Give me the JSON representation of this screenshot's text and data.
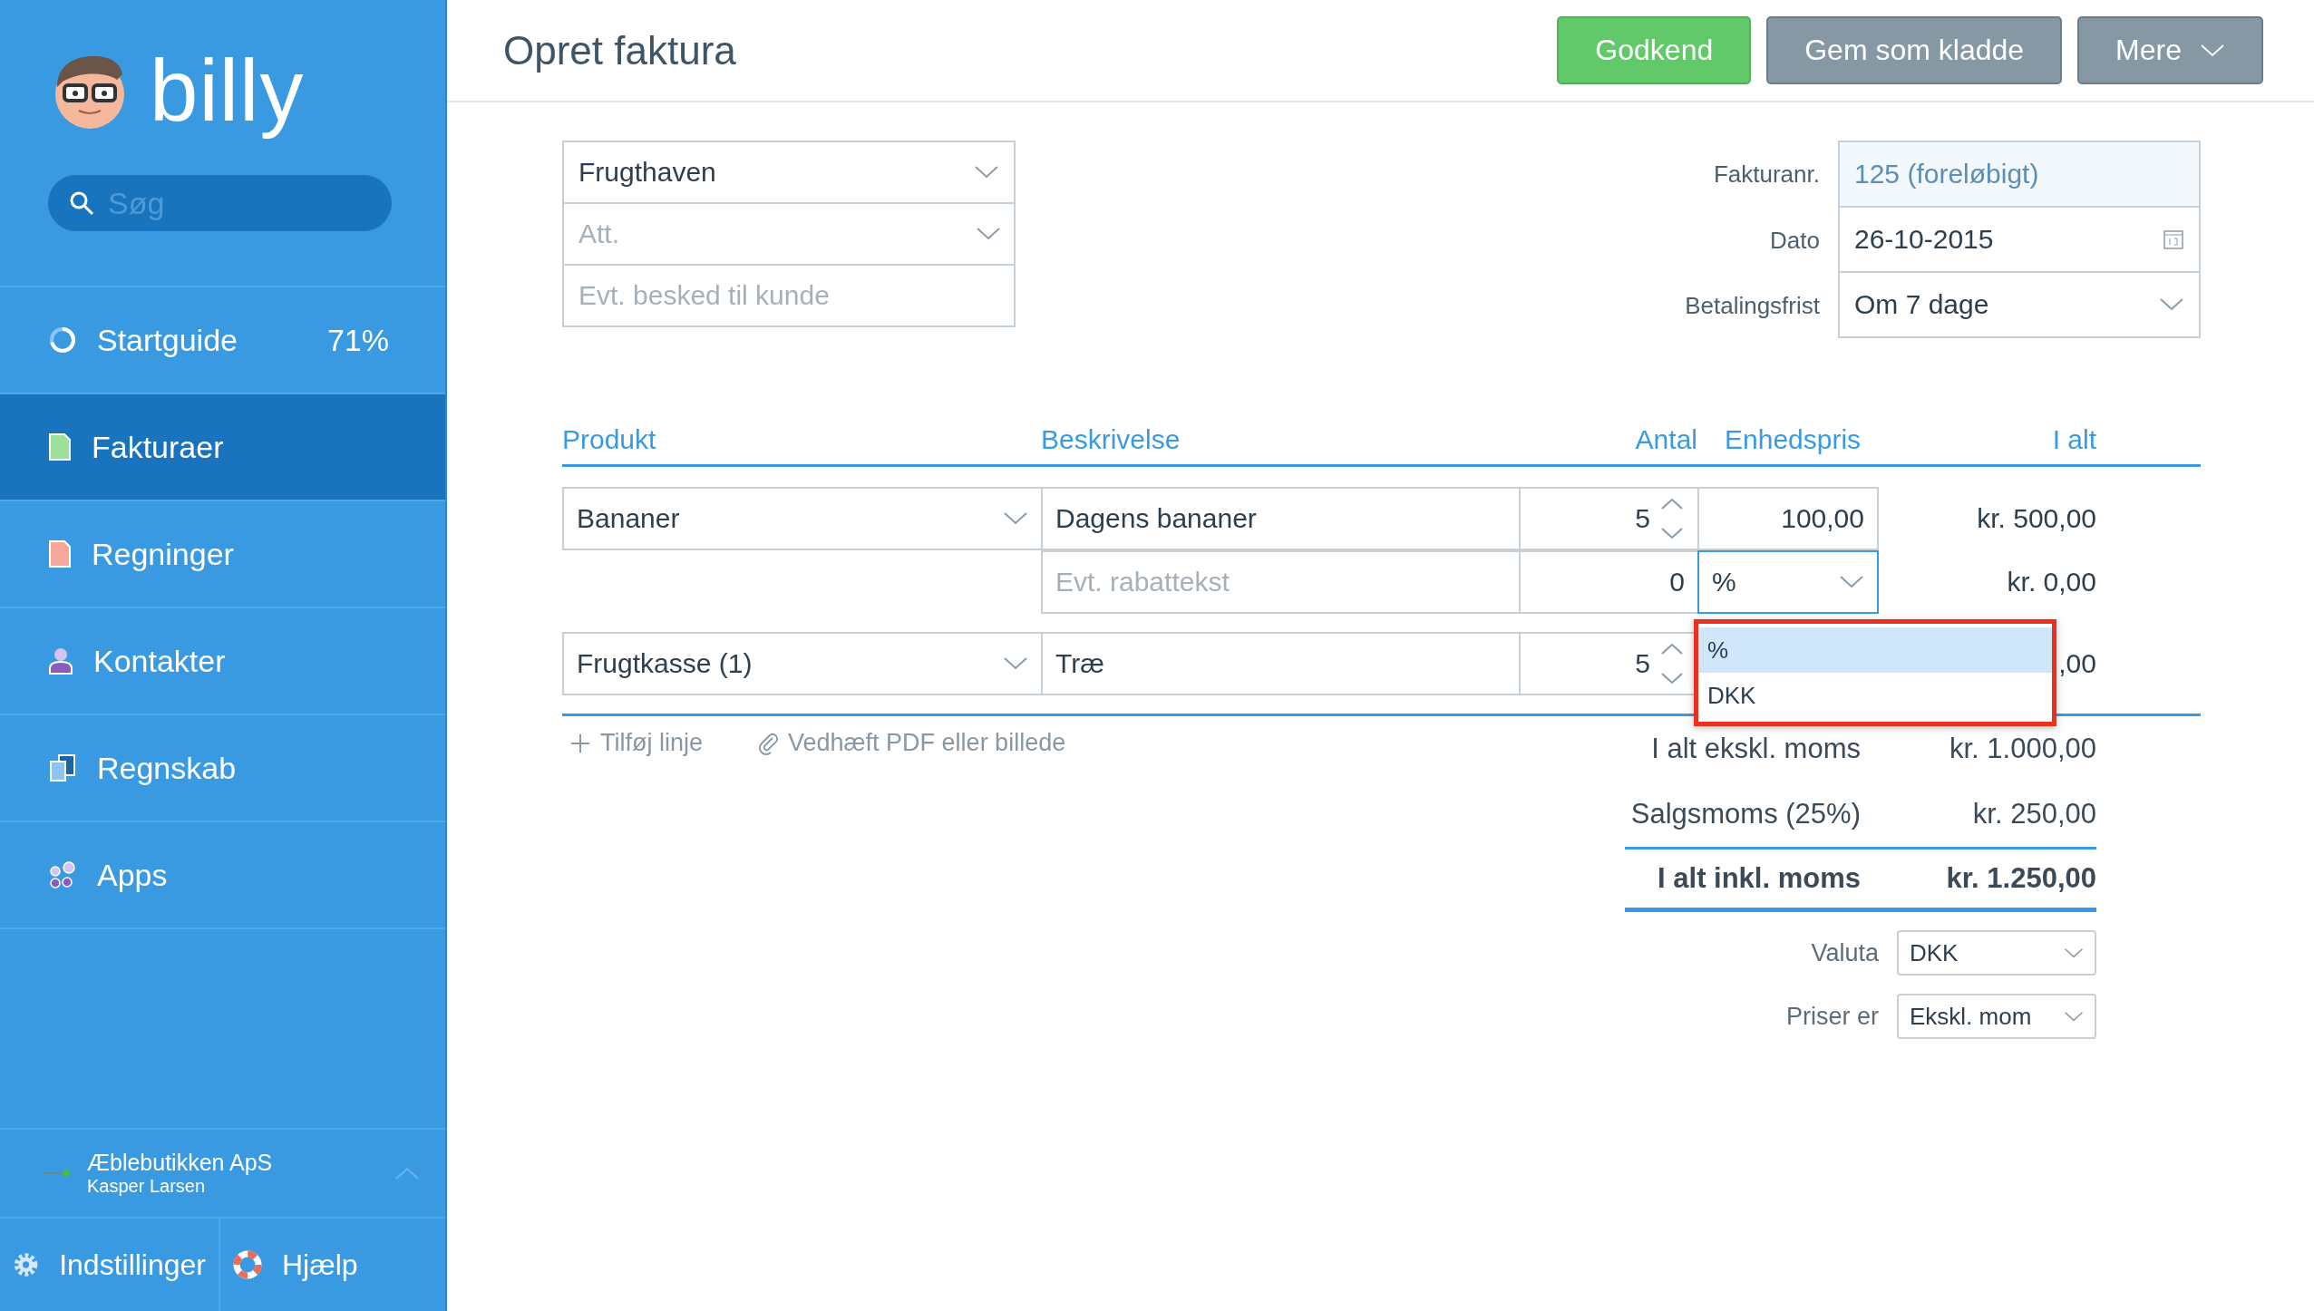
{
  "sidebar": {
    "logo": "billy",
    "search": {
      "placeholder": "Søg"
    },
    "items": [
      {
        "kind": "progress",
        "label": "Startguide",
        "badge": "71%",
        "level": 0.71,
        "selected": false
      },
      {
        "kind": "invoice",
        "label": "Fakturaer",
        "selected": true
      },
      {
        "kind": "bill",
        "label": "Regninger",
        "selected": false
      },
      {
        "kind": "contact",
        "label": "Kontakter",
        "selected": false
      },
      {
        "kind": "accounting",
        "label": "Regnskab",
        "selected": false
      },
      {
        "kind": "apps",
        "label": "Apps",
        "selected": false
      }
    ],
    "account": {
      "company": "Æblebutikken ApS",
      "user": "Kasper Larsen"
    },
    "footer": [
      {
        "kind": "settings",
        "label": "Indstillinger"
      },
      {
        "kind": "help",
        "label": "Hjælp"
      }
    ]
  },
  "header": {
    "title": "Opret faktura",
    "buttons": [
      {
        "kind": "primary",
        "label": "Godkend"
      },
      {
        "kind": "secondary",
        "label": "Gem som kladde"
      },
      {
        "kind": "menu",
        "label": "Mere"
      }
    ]
  },
  "customer": {
    "contact": "Frugthaven",
    "att_placeholder": "Att.",
    "message_placeholder": "Evt. besked til kunde"
  },
  "invoice_meta": [
    {
      "kind": "readonly",
      "label": "Fakturanr.",
      "value": "125 (foreløbigt)"
    },
    {
      "kind": "date",
      "label": "Dato",
      "value": "26-10-2015"
    },
    {
      "kind": "select",
      "label": "Betalingsfrist",
      "value": "Om 7 dage"
    }
  ],
  "lines": {
    "columns": [
      "Produkt",
      "Beskrivelse",
      "Antal",
      "Enhedspris",
      "I alt"
    ],
    "rows": [
      {
        "kind": "product",
        "product": "Bananer",
        "description": "Dagens bananer",
        "quantity": "5",
        "price": "100,00",
        "total": "kr. 500,00"
      },
      {
        "kind": "discount",
        "placeholder": "Evt. rabattekst",
        "quantity": "0",
        "unit": "%",
        "total": "kr. 0,00",
        "menu": [
          {
            "label": "%",
            "selected": true
          },
          {
            "label": "DKK",
            "selected": false
          }
        ]
      },
      {
        "kind": "product",
        "product": "Frugtkasse (1)",
        "description": "Træ",
        "quantity": "5",
        "total": ",00"
      }
    ]
  },
  "actions": [
    {
      "kind": "add",
      "label": "Tilføj linje"
    },
    {
      "kind": "attach",
      "label": "Vedhæft PDF eller billede"
    }
  ],
  "totals": [
    {
      "label": "I alt ekskl. moms",
      "value": "kr. 1.000,00",
      "bold": false
    },
    {
      "label": "Salgsmoms (25%)",
      "value": "kr. 250,00",
      "bold": false
    },
    {
      "label": "I alt inkl. moms",
      "value": "kr. 1.250,00",
      "bold": true
    }
  ],
  "options": [
    {
      "label": "Valuta",
      "value": "DKK"
    },
    {
      "label": "Priser er",
      "value": "Ekskl. mom"
    }
  ]
}
